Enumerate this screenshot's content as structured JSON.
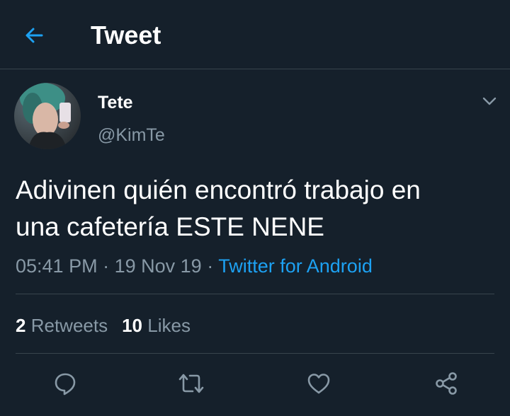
{
  "header": {
    "title": "Tweet",
    "back_icon": "arrow-left-icon"
  },
  "tweet": {
    "display_name": "Tete",
    "handle": "@KimTe",
    "text_lines": [
      "Adivinen quién encontró trabajo en",
      "una cafetería ESTE NENE"
    ],
    "time": "05:41 PM",
    "separator": "·",
    "date": "19 Nov 19",
    "source": "Twitter for Android"
  },
  "stats": {
    "retweets_count": "2",
    "retweets_label": "Retweets",
    "likes_count": "10",
    "likes_label": "Likes"
  },
  "actions": {
    "icons": [
      "reply-icon",
      "retweet-icon",
      "like-icon",
      "share-icon"
    ]
  },
  "colors": {
    "background": "#15202b",
    "accent": "#1da1f2",
    "secondary_text": "#8899a6",
    "divider": "#38444d"
  }
}
